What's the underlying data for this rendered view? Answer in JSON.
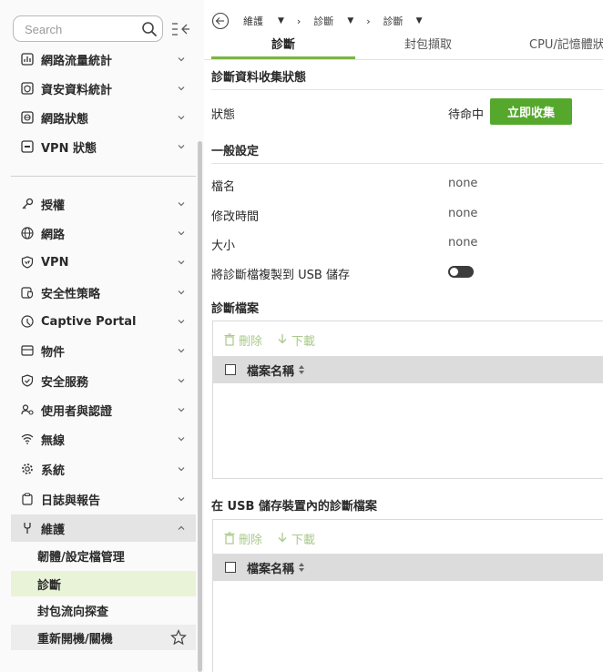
{
  "search": {
    "placeholder": "Search"
  },
  "sidebar": {
    "top_items": [
      {
        "label": "網路流量統計",
        "icon": "traffic-stats-icon"
      },
      {
        "label": "資安資料統計",
        "icon": "security-stats-icon"
      },
      {
        "label": "網路狀態",
        "icon": "network-status-icon"
      },
      {
        "label": "VPN 狀態",
        "icon": "vpn-status-icon"
      }
    ],
    "items": [
      {
        "label": "授權",
        "icon": "key-icon"
      },
      {
        "label": "網路",
        "icon": "globe-icon"
      },
      {
        "label": "VPN",
        "icon": "vpn-shield-icon"
      },
      {
        "label": "安全性策略",
        "icon": "policy-icon"
      },
      {
        "label": "Captive Portal",
        "icon": "captive-portal-icon"
      },
      {
        "label": "物件",
        "icon": "object-icon"
      },
      {
        "label": "安全服務",
        "icon": "security-service-icon"
      },
      {
        "label": "使用者與認證",
        "icon": "user-auth-icon"
      },
      {
        "label": "無線",
        "icon": "wifi-icon"
      },
      {
        "label": "系統",
        "icon": "gear-icon"
      },
      {
        "label": "日誌與報告",
        "icon": "clipboard-icon"
      },
      {
        "label": "維護",
        "icon": "wrench-icon"
      }
    ],
    "sub_items": [
      {
        "label": "韌體/設定檔管理"
      },
      {
        "label": "診斷"
      },
      {
        "label": "封包流向探查"
      },
      {
        "label": "重新開機/關機"
      }
    ]
  },
  "breadcrumb": {
    "level1": "維護",
    "level2": "診斷",
    "level3": "診斷"
  },
  "tabs": [
    "診斷",
    "封包擷取",
    "CPU/記憶體狀"
  ],
  "collect": {
    "title": "診斷資料收集狀態",
    "status_label": "狀態",
    "status_value": "待命中",
    "button": "立即收集"
  },
  "general": {
    "title": "一般設定",
    "rows": [
      {
        "label": "檔名",
        "value": "none"
      },
      {
        "label": "修改時間",
        "value": "none"
      },
      {
        "label": "大小",
        "value": "none"
      }
    ],
    "usb_copy_label": "將診斷檔複製到 USB 儲存",
    "usb_copy_enabled": false
  },
  "diag_files": {
    "title": "診斷檔案",
    "delete": "刪除",
    "download": "下載",
    "column": "檔案名稱"
  },
  "usb_files": {
    "title": "在 USB 儲存裝置內的診斷檔案",
    "delete": "刪除",
    "download": "下載",
    "column": "檔案名稱"
  },
  "colors": {
    "accent": "#55a82c",
    "tab_underline": "#7cb342",
    "selected_bg": "#e8f3d8"
  }
}
